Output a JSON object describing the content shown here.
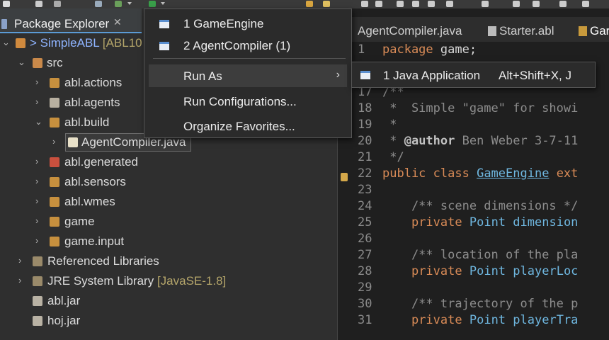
{
  "package_explorer": {
    "tab_label": "Package Explorer",
    "close_glyph": "✕",
    "tree": [
      {
        "label": "> SimpleABL",
        "suffix": "[ABL10",
        "icon": "project-icon"
      },
      {
        "label": "src",
        "icon": "source-folder-icon"
      },
      {
        "label": "abl.actions",
        "icon": "package-icon"
      },
      {
        "label": "abl.agents",
        "icon": "package-icon"
      },
      {
        "label": "abl.build",
        "icon": "package-icon"
      },
      {
        "label": "AgentCompiler.java",
        "icon": "java-file-icon"
      },
      {
        "label": "abl.generated",
        "icon": "package-icon"
      },
      {
        "label": "abl.sensors",
        "icon": "package-icon"
      },
      {
        "label": "abl.wmes",
        "icon": "package-icon"
      },
      {
        "label": "game",
        "icon": "package-icon"
      },
      {
        "label": "game.input",
        "icon": "package-icon"
      },
      {
        "label": "Referenced Libraries",
        "icon": "library-icon"
      },
      {
        "label": "JRE System Library",
        "suffix": "[JavaSE-1.8]",
        "icon": "library-icon"
      },
      {
        "label": "abl.jar",
        "icon": "jar-icon"
      },
      {
        "label": "hoj.jar",
        "icon": "jar-icon"
      }
    ]
  },
  "editor": {
    "tabs": [
      "AgentCompiler.java",
      "Starter.abl",
      "Gar"
    ],
    "lines": [
      {
        "num": "1",
        "text": "package game;"
      },
      {
        "num": "17",
        "text": "/**"
      },
      {
        "num": "18",
        "text": " *  Simple \"game\" for showi"
      },
      {
        "num": "19",
        "text": " *"
      },
      {
        "num": "20",
        "text": " * @author Ben Weber 3-7-11"
      },
      {
        "num": "21",
        "text": " */"
      },
      {
        "num": "22",
        "text": "public class GameEngine ext"
      },
      {
        "num": "23",
        "text": ""
      },
      {
        "num": "24",
        "text": "    /** scene dimensions */"
      },
      {
        "num": "25",
        "text": "    private Point dimension"
      },
      {
        "num": "26",
        "text": ""
      },
      {
        "num": "27",
        "text": "    /** location of the pla"
      },
      {
        "num": "28",
        "text": "    private Point playerLoc"
      },
      {
        "num": "29",
        "text": ""
      },
      {
        "num": "30",
        "text": "    /** trajectory of the p"
      },
      {
        "num": "31",
        "text": "    private Point playerTra"
      }
    ]
  },
  "menu": {
    "items": [
      {
        "label": "1 GameEngine"
      },
      {
        "label": "2 AgentCompiler (1)"
      },
      {
        "label": "Run As"
      },
      {
        "label": "Run Configurations..."
      },
      {
        "label": "Organize Favorites..."
      }
    ],
    "submenu_glyph": "›",
    "submenu": {
      "label": "1 Java Application",
      "accelerator": "Alt+Shift+X, J"
    }
  },
  "colors": {
    "background": "#2b2b2b",
    "keyword": "#d98b57",
    "comment": "#8c8c8c",
    "type": "#6fb7e0"
  }
}
